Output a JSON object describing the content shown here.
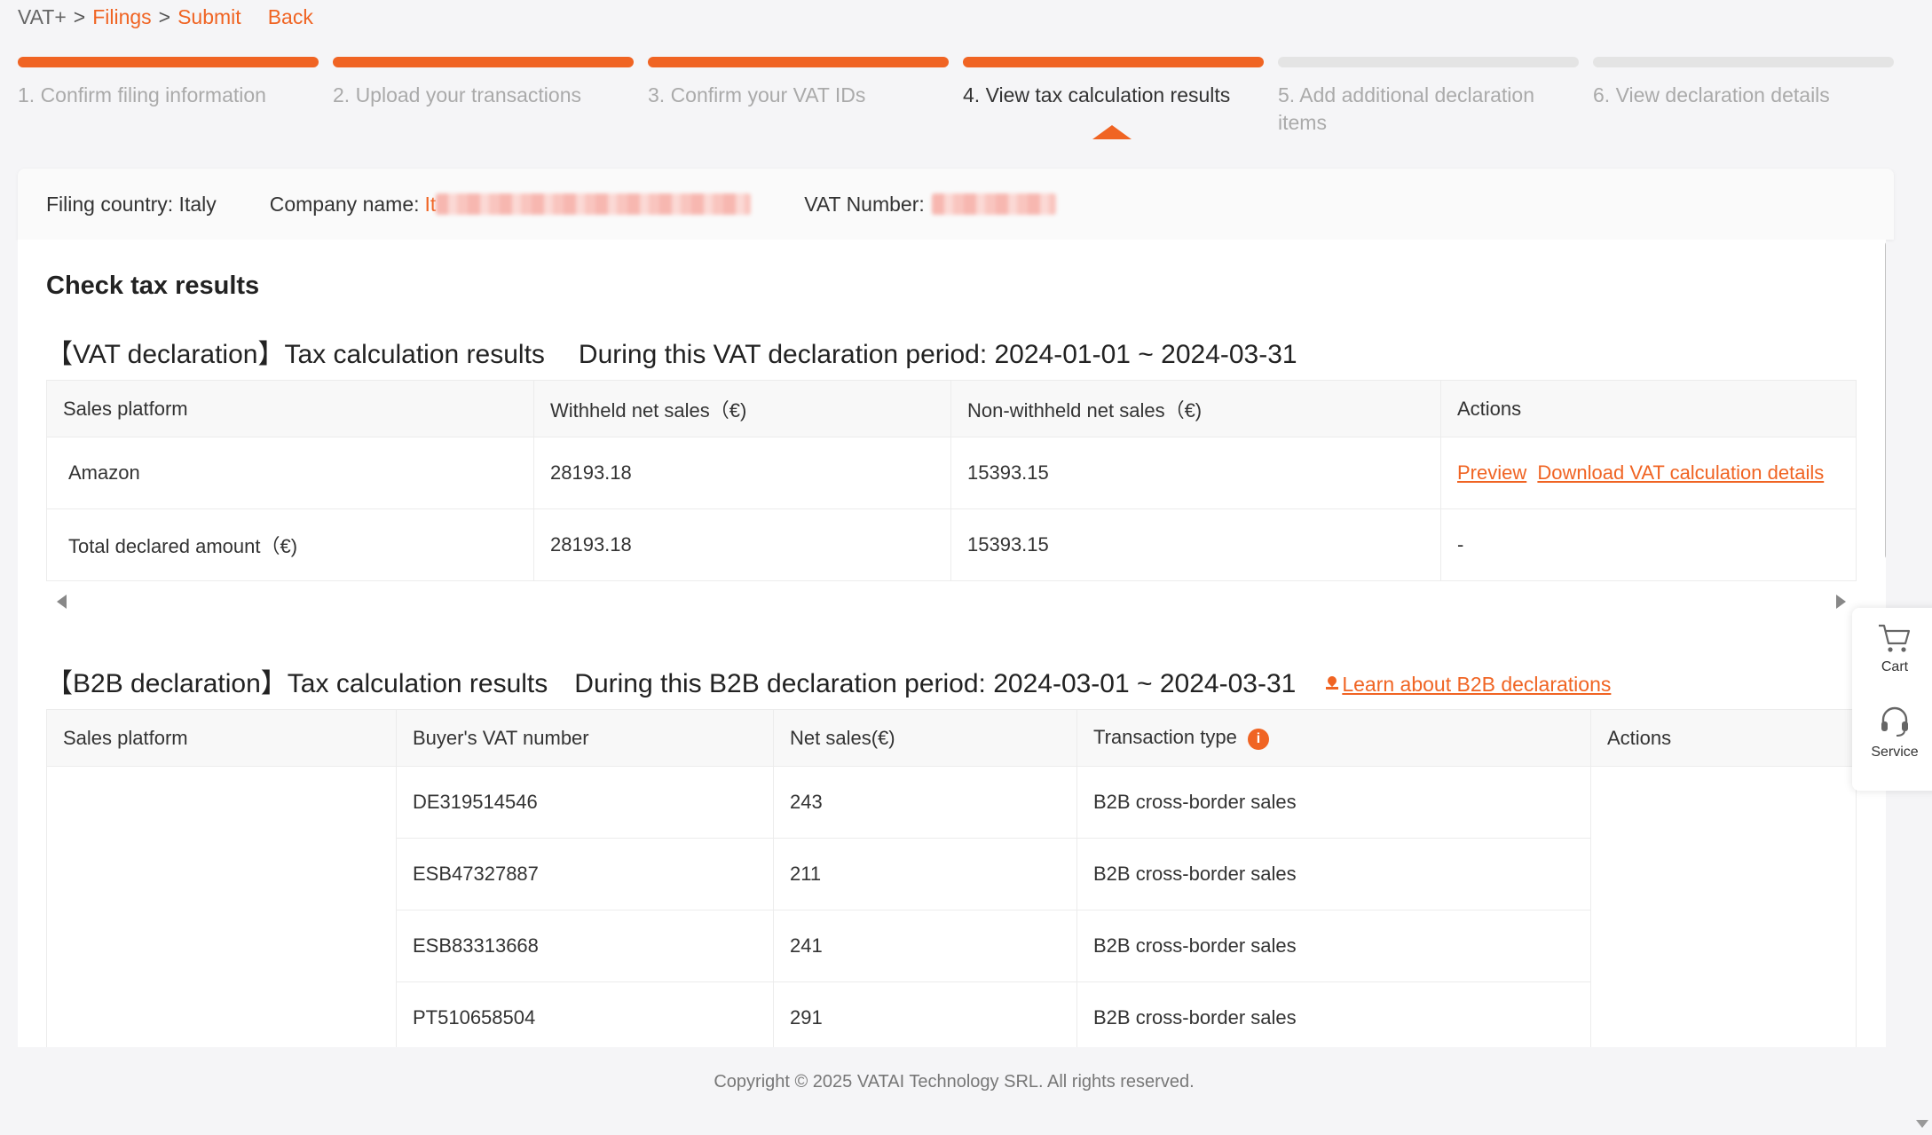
{
  "breadcrumb": {
    "root": "VAT+",
    "sep": ">",
    "filings": "Filings",
    "submit": "Submit",
    "back": "Back"
  },
  "steps": [
    {
      "label": "1. Confirm filing information",
      "status": "done"
    },
    {
      "label": "2. Upload your transactions",
      "status": "done"
    },
    {
      "label": "3. Confirm your VAT IDs",
      "status": "done"
    },
    {
      "label": "4. View tax calculation results",
      "status": "current"
    },
    {
      "label": "5. Add additional declaration items",
      "status": "pending"
    },
    {
      "label": "6. View declaration details",
      "status": "pending"
    }
  ],
  "info": {
    "country_label": "Filing country: Italy",
    "company_label": "Company name:",
    "company_value_prefix": "It",
    "vat_label": "VAT Number:"
  },
  "main": {
    "title": "Check tax results",
    "vat_section": {
      "heading": "【VAT declaration】Tax calculation results",
      "period": "During this VAT declaration period: 2024-01-01 ~ 2024-03-31",
      "columns": [
        "Sales platform",
        "Withheld net sales（€)",
        "Non-withheld net sales（€)",
        "Actions"
      ],
      "rows": [
        {
          "platform": "Amazon",
          "withheld": "28193.18",
          "non_withheld": "15393.15",
          "preview": "Preview",
          "download": "Download VAT calculation details"
        },
        {
          "platform": "Total declared amount（€)",
          "withheld": "28193.18",
          "non_withheld": "15393.15",
          "actions": "-"
        }
      ]
    },
    "b2b_section": {
      "heading": "【B2B declaration】Tax calculation results",
      "period": "During this B2B declaration period: 2024-03-01 ~ 2024-03-31",
      "learn_link": "Learn about B2B declarations",
      "columns": [
        "Sales platform",
        "Buyer's VAT number",
        "Net sales(€)",
        "Transaction type",
        "Actions"
      ],
      "info_icon": "i",
      "rows": [
        {
          "vat": "DE319514546",
          "net": "243",
          "type": "B2B cross-border sales"
        },
        {
          "vat": "ESB47327887",
          "net": "211",
          "type": "B2B cross-border sales"
        },
        {
          "vat": "ESB83313668",
          "net": "241",
          "type": "B2B cross-border sales"
        },
        {
          "vat": "PT510658504",
          "net": "291",
          "type": "B2B cross-border sales"
        }
      ]
    }
  },
  "side": {
    "cart": "Cart",
    "service": "Service"
  },
  "footer": "Copyright © 2025 VATAI Technology SRL. All rights reserved.",
  "colors": {
    "accent": "#f06423"
  },
  "icons": [
    "cart-icon",
    "headset-icon",
    "info-icon",
    "learn-icon",
    "scroll-left-icon",
    "scroll-right-icon"
  ]
}
